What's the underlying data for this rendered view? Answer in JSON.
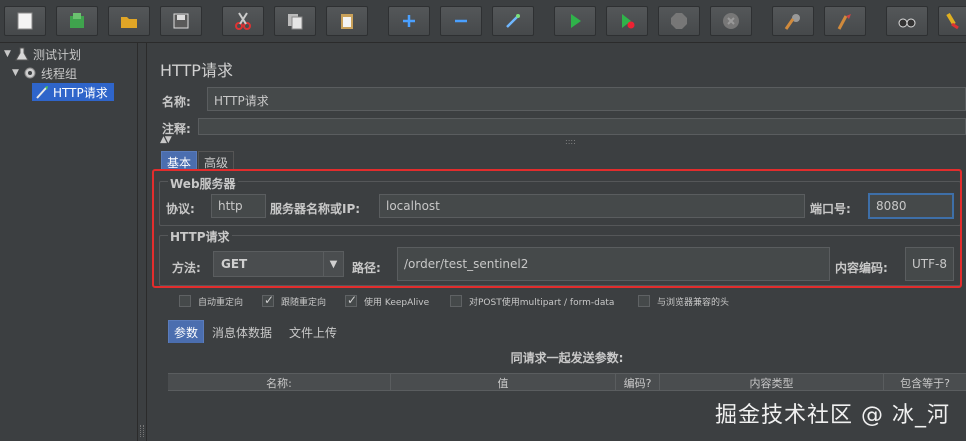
{
  "tree": {
    "plan": "测试计划",
    "thread_group": "线程组",
    "http_request": "HTTP请求"
  },
  "panel": {
    "title": "HTTP请求",
    "name_label": "名称:",
    "name_value": "HTTP请求",
    "comment_label": "注释:",
    "comment_value": ""
  },
  "tabs": [
    "基本",
    "高级"
  ],
  "web_server": {
    "title": "Web服务器",
    "protocol_label": "协议:",
    "protocol_value": "http",
    "server_label": "服务器名称或IP:",
    "server_value": "localhost",
    "port_label": "端口号:",
    "port_value": "8080"
  },
  "http_request": {
    "title": "HTTP请求",
    "method_label": "方法:",
    "method_value": "GET",
    "path_label": "路径:",
    "path_value": "/order/test_sentinel2",
    "encoding_label": "内容编码:",
    "encoding_value": "UTF-8"
  },
  "options": [
    {
      "label": "自动重定向",
      "checked": false
    },
    {
      "label": "跟随重定向",
      "checked": true
    },
    {
      "label": "使用 KeepAlive",
      "checked": true
    },
    {
      "label": "对POST使用multipart / form-data",
      "checked": false
    },
    {
      "label": "与浏览器兼容的头",
      "checked": false
    }
  ],
  "param_tabs": [
    "参数",
    "消息体数据",
    "文件上传"
  ],
  "params_table": {
    "title": "同请求一起发送参数:",
    "columns": [
      "名称:",
      "值",
      "编码?",
      "内容类型",
      "包含等于?"
    ]
  },
  "watermark": "掘金技术社区 @ 冰_河",
  "colors": {
    "highlight_border": "#e22d2d",
    "selection": "#2f65ca",
    "active_tab": "#4b6eaf"
  }
}
